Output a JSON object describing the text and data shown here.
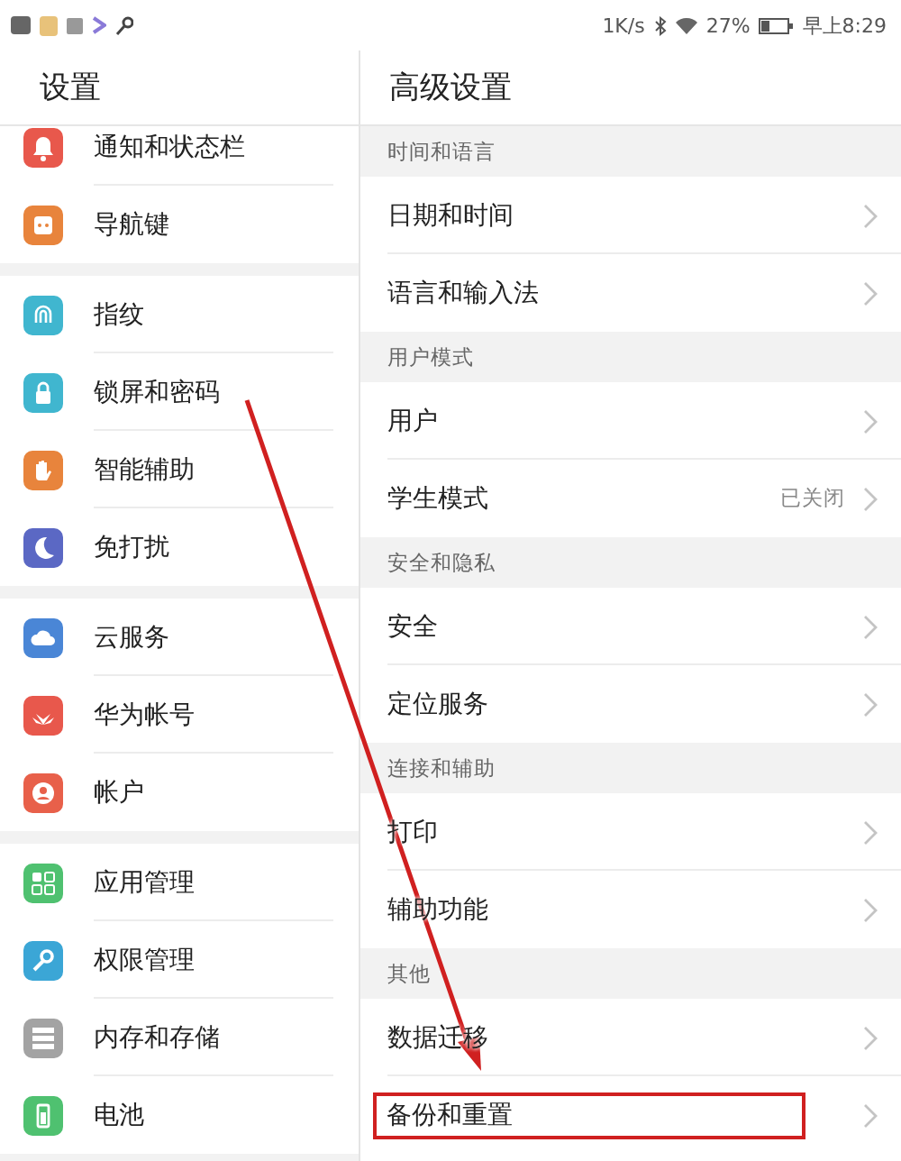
{
  "status_bar": {
    "speed": "1K/s",
    "battery": "27%",
    "time": "早上8:29"
  },
  "left": {
    "title": "设置",
    "groups": [
      [
        {
          "label": "通知和状态栏",
          "color": "#e8584c"
        },
        {
          "label": "导航键",
          "color": "#e8843c"
        }
      ],
      [
        {
          "label": "指纹",
          "color": "#40b6cf"
        },
        {
          "label": "锁屏和密码",
          "color": "#40b6cf"
        },
        {
          "label": "智能辅助",
          "color": "#e8843c"
        },
        {
          "label": "免打扰",
          "color": "#5b68c4"
        }
      ],
      [
        {
          "label": "云服务",
          "color": "#4a86d6"
        },
        {
          "label": "华为帐号",
          "color": "#e8584c"
        },
        {
          "label": "帐户",
          "color": "#e8604a"
        }
      ],
      [
        {
          "label": "应用管理",
          "color": "#4fc170"
        },
        {
          "label": "权限管理",
          "color": "#3ba6d6"
        },
        {
          "label": "内存和存储",
          "color": "#a3a3a3"
        },
        {
          "label": "电池",
          "color": "#4fc170"
        }
      ]
    ]
  },
  "right": {
    "title": "高级设置",
    "sections": [
      {
        "header": "时间和语言",
        "items": [
          {
            "label": "日期和时间",
            "highlighted": false
          },
          {
            "label": "语言和输入法",
            "highlighted": false
          }
        ]
      },
      {
        "header": "用户模式",
        "items": [
          {
            "label": "用户",
            "highlighted": false
          },
          {
            "label": "学生模式",
            "value": "已关闭",
            "highlighted": false
          }
        ]
      },
      {
        "header": "安全和隐私",
        "items": [
          {
            "label": "安全",
            "highlighted": false
          },
          {
            "label": "定位服务",
            "highlighted": false
          }
        ]
      },
      {
        "header": "连接和辅助",
        "items": [
          {
            "label": "打印",
            "highlighted": false
          },
          {
            "label": "辅助功能",
            "highlighted": false
          }
        ]
      },
      {
        "header": "其他",
        "items": [
          {
            "label": "数据迁移",
            "highlighted": false
          },
          {
            "label": "备份和重置",
            "highlighted": true
          }
        ]
      }
    ]
  }
}
